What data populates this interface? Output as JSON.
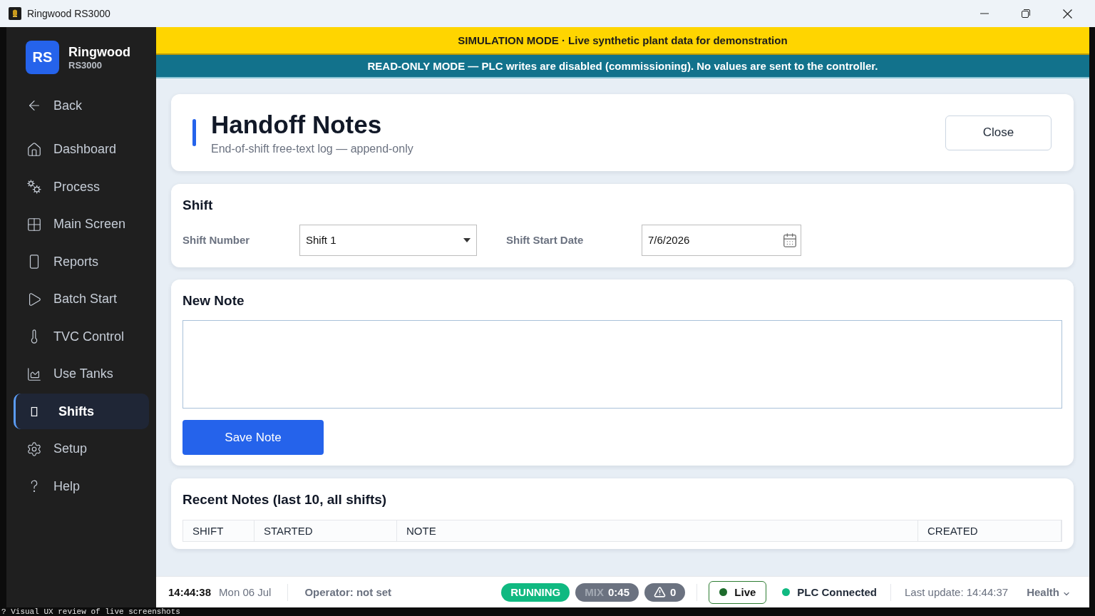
{
  "window": {
    "title": "Ringwood RS3000"
  },
  "sidebar": {
    "logo": "RS",
    "brand": "Ringwood",
    "model": "RS3000",
    "back": "Back",
    "items": [
      {
        "label": "Dashboard",
        "selected": false
      },
      {
        "label": "Process",
        "selected": false
      },
      {
        "label": "Main Screen",
        "selected": false
      },
      {
        "label": "Reports",
        "selected": false
      },
      {
        "label": "Batch Start",
        "selected": false
      },
      {
        "label": "TVC Control",
        "selected": false
      },
      {
        "label": "Use Tanks",
        "selected": false
      },
      {
        "label": "Shifts",
        "selected": true
      },
      {
        "label": "Setup",
        "selected": false
      },
      {
        "label": "Help",
        "selected": false
      }
    ]
  },
  "banners": [
    {
      "kind": "simulation",
      "text": "SIMULATION MODE · Live synthetic plant data for demonstration"
    },
    {
      "kind": "readonly",
      "text": "READ-ONLY MODE — PLC writes are disabled (commissioning). No values are sent to the controller."
    }
  ],
  "page": {
    "title": "Handoff Notes",
    "subtitle": "End-of-shift free-text log — append-only",
    "close_button": "Close"
  },
  "shift_section": {
    "heading": "Shift",
    "fields": [
      {
        "kind": "select",
        "label": "Shift Number",
        "value": "Shift 1"
      },
      {
        "kind": "date",
        "label": "Shift Start Date",
        "value": "7/6/2026"
      }
    ]
  },
  "new_note": {
    "heading": "New Note",
    "save_button": "Save Note"
  },
  "recent_notes": {
    "heading": "Recent Notes (last 10, all shifts)",
    "columns": [
      "SHIFT",
      "STARTED",
      "NOTE",
      "CREATED"
    ]
  },
  "status_bar": {
    "time": "14:44:38",
    "date": "Mon 06 Jul",
    "operator": "Operator: not set",
    "badges": [
      {
        "kind": "state",
        "text": "RUNNING"
      },
      {
        "kind": "mix",
        "label": "MIX",
        "text": "0:45"
      },
      {
        "kind": "alarms",
        "text": "0"
      }
    ],
    "indicators": [
      {
        "kind": "button",
        "label": "Live",
        "color": "#1e6b2c"
      },
      {
        "kind": "plain",
        "label": "PLC Connected",
        "color": "#10b981"
      }
    ],
    "last_update": "Last update: 14:44:37",
    "health": "Health"
  },
  "terminal": {
    "line": "? Visual UX review of live screenshots"
  }
}
